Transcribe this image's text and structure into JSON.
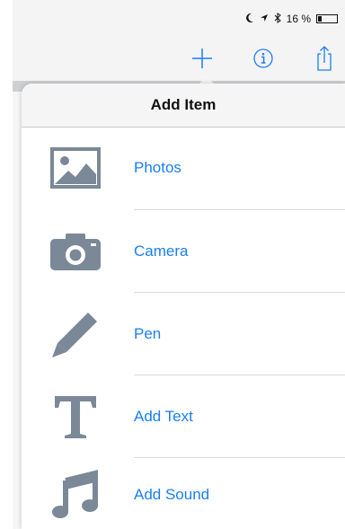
{
  "status": {
    "battery_text": "16 %"
  },
  "popover": {
    "title": "Add Item",
    "items": [
      {
        "label": "Photos",
        "icon": "photo-icon"
      },
      {
        "label": "Camera",
        "icon": "camera-icon"
      },
      {
        "label": "Pen",
        "icon": "pen-icon"
      },
      {
        "label": "Add Text",
        "icon": "text-icon"
      },
      {
        "label": "Add Sound",
        "icon": "music-note-icon"
      }
    ]
  },
  "colors": {
    "accent": "#1a7ff3",
    "icon_gray": "#7b8897"
  }
}
